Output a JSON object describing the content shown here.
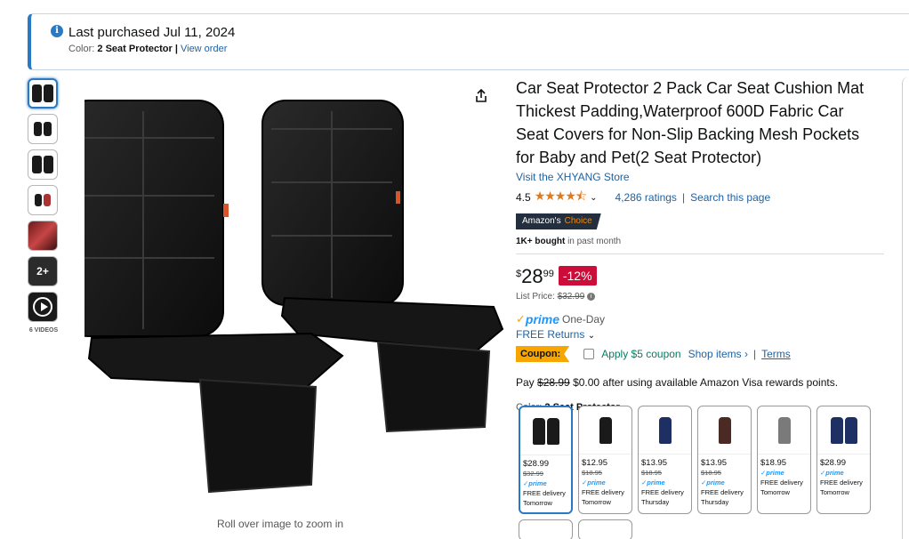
{
  "banner": {
    "title": "Last purchased Jul 11, 2024",
    "color_label": "Color:",
    "color_value": "2 Seat Protector",
    "separator": "|",
    "view_order": "View order"
  },
  "thumbnails": {
    "videos_label": "6 VIDEOS",
    "badge_text": "2+"
  },
  "zoom_hint": "Roll over image to zoom in",
  "product": {
    "title": "Car Seat Protector 2 Pack Car Seat Cushion Mat Thickest Padding,Waterproof 600D Fabric Car Seat Covers for Non-Slip Backing Mesh Pockets for Baby and Pet(2 Seat Protector)",
    "store": "Visit the XHYANG Store",
    "rating": "4.5",
    "stars": "★★★★⯪",
    "rating_fraction": 0.9,
    "ratings_count": "4,286 ratings",
    "search_page": "Search this page",
    "choice_left": "Amazon's",
    "choice_right": "Choice",
    "bought_bold": "1K+ bought",
    "bought_rest": "in past month",
    "price_symbol": "$",
    "price_whole": "28",
    "price_fraction": "99",
    "discount": "-12%",
    "list_price_label": "List Price:",
    "list_price": "$32.99",
    "prime_word": "prime",
    "prime_speed": "One-Day",
    "free_returns": "FREE Returns",
    "coupon_badge": "Coupon:",
    "coupon_text": "Apply $5 coupon",
    "shop_items": "Shop items ›",
    "terms": "Terms",
    "pay_prefix": "Pay",
    "pay_strike": "$28.99",
    "pay_rest": "$0.00 after using available Amazon Visa rewards points.",
    "color_label": "Color:",
    "color_value": "2 Seat Protector"
  },
  "swatches": [
    {
      "price": "$28.99",
      "old": "$32.99",
      "prime": "prime",
      "delivery": "FREE delivery",
      "day": "Tomorrow",
      "color": "#1a1a1a",
      "count": 2
    },
    {
      "price": "$12.95",
      "old": "$18.95",
      "prime": "prime",
      "delivery": "FREE delivery",
      "day": "Tomorrow",
      "color": "#1a1a1a",
      "count": 1
    },
    {
      "price": "$13.95",
      "old": "$18.95",
      "prime": "prime",
      "delivery": "FREE delivery",
      "day": "Thursday",
      "color": "#1e2f63",
      "count": 1
    },
    {
      "price": "$13.95",
      "old": "$18.95",
      "prime": "prime",
      "delivery": "FREE delivery",
      "day": "Thursday",
      "color": "#4a2a22",
      "count": 1
    },
    {
      "price": "$18.95",
      "old": "",
      "prime": "prime",
      "delivery": "FREE delivery",
      "day": "Tomorrow",
      "color": "#7a7a7a",
      "count": 1
    },
    {
      "price": "$28.99",
      "old": "",
      "prime": "prime",
      "delivery": "FREE delivery",
      "day": "Tomorrow",
      "color": "#1e2f63",
      "count": 2
    }
  ]
}
